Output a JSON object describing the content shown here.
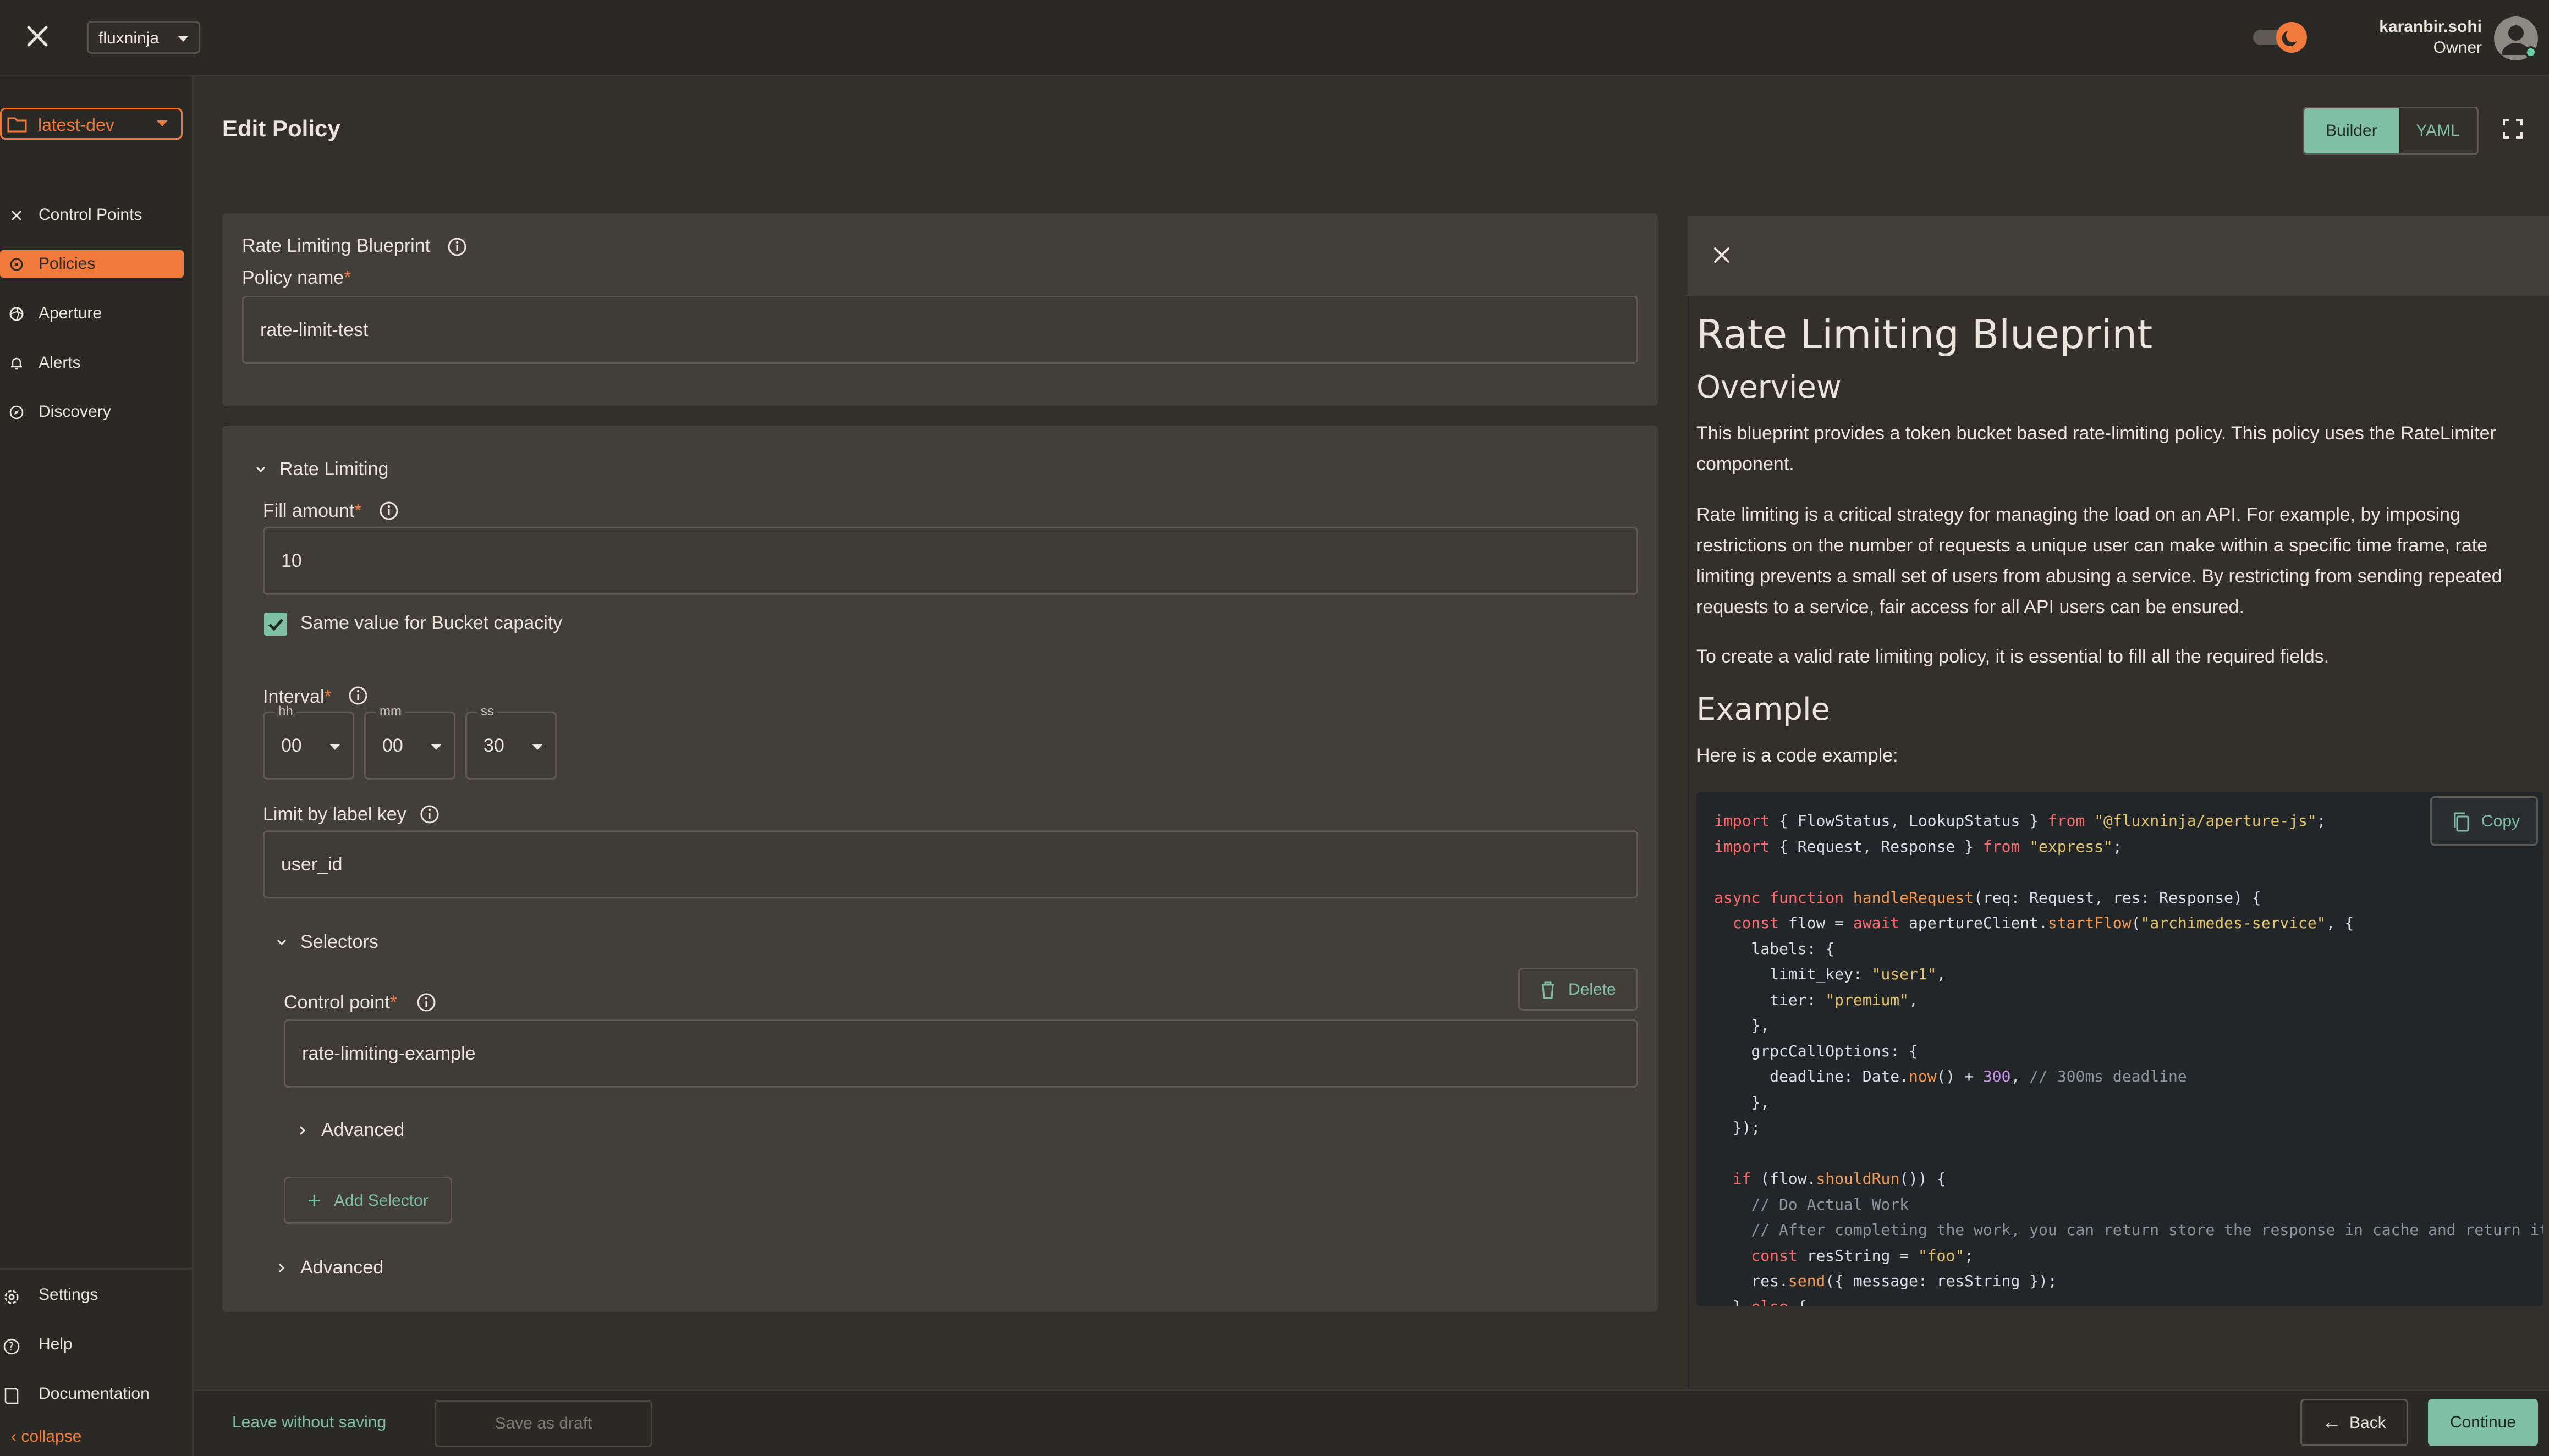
{
  "topbar": {
    "org": "fluxninja",
    "user_name": "karanbir.sohi",
    "user_role": "Owner"
  },
  "sidebar": {
    "project": "latest-dev",
    "items": [
      {
        "label": "Control Points",
        "icon": "crosshair-icon"
      },
      {
        "label": "Policies",
        "icon": "policy-icon"
      },
      {
        "label": "Aperture",
        "icon": "aperture-icon"
      },
      {
        "label": "Alerts",
        "icon": "bell-icon"
      },
      {
        "label": "Discovery",
        "icon": "compass-icon"
      }
    ],
    "bottom_items": [
      {
        "label": "Settings",
        "icon": "gear-icon"
      },
      {
        "label": "Help",
        "icon": "help-icon"
      },
      {
        "label": "Documentation",
        "icon": "book-icon"
      }
    ],
    "collapse": "collapse"
  },
  "header": {
    "title": "Edit Policy",
    "builder": "Builder",
    "yaml": "YAML"
  },
  "form": {
    "blueprint_label": "Rate Limiting Blueprint",
    "policy_name_label": "Policy name",
    "policy_name_value": "rate-limit-test",
    "section_rate_limiting": "Rate Limiting",
    "fill_amount_label": "Fill amount",
    "fill_amount_value": "10",
    "same_value_label": "Same value for Bucket capacity",
    "interval_label": "Interval",
    "interval": {
      "hh_label": "hh",
      "hh": "00",
      "mm_label": "mm",
      "mm": "00",
      "ss_label": "ss",
      "ss": "30"
    },
    "limit_label_key_label": "Limit by label key",
    "limit_label_key_value": "user_id",
    "selectors_label": "Selectors",
    "delete_label": "Delete",
    "control_point_label": "Control point",
    "control_point_value": "rate-limiting-example",
    "advanced_inner": "Advanced",
    "add_selector": "Add Selector",
    "advanced_outer": "Advanced",
    "required_mark": "*"
  },
  "docs": {
    "title": "Rate Limiting Blueprint",
    "overview_heading": "Overview",
    "p1": "This blueprint provides a token bucket based rate-limiting policy. This policy uses the RateLimiter component.",
    "p2": "Rate limiting is a critical strategy for managing the load on an API. For example, by imposing restrictions on the number of requests a unique user can make within a specific time frame, rate limiting prevents a small set of users from abusing a service. By restricting from sending repeated requests to a service, fair access for all API users can be ensured.",
    "p3": "To create a valid rate limiting policy, it is essential to fill all the required fields.",
    "example_heading": "Example",
    "example_intro": "Here is a code example:",
    "copy": "Copy",
    "code_lines": [
      "import { FlowStatus, LookupStatus } from \"@fluxninja/aperture-js\";",
      "import { Request, Response } from \"express\";",
      "",
      "async function handleRequest(req: Request, res: Response) {",
      "  const flow = await apertureClient.startFlow(\"archimedes-service\", {",
      "    labels: {",
      "      limit_key: \"user1\",",
      "      tier: \"premium\",",
      "    },",
      "    grpcCallOptions: {",
      "      deadline: Date.now() + 300, // 300ms deadline",
      "    },",
      "  });",
      "",
      "  if (flow.shouldRun()) {",
      "    // Do Actual Work",
      "    // After completing the work, you can return store the response in cache and return it,",
      "    const resString = \"foo\";",
      "    res.send({ message: resString });",
      "  } else {"
    ]
  },
  "footer": {
    "leave": "Leave without saving",
    "save_draft": "Save as draft",
    "back": "Back",
    "continue": "Continue"
  },
  "colors": {
    "accent_orange": "#f07a3c",
    "accent_green": "#7fbfa6",
    "background": "#33302c"
  }
}
